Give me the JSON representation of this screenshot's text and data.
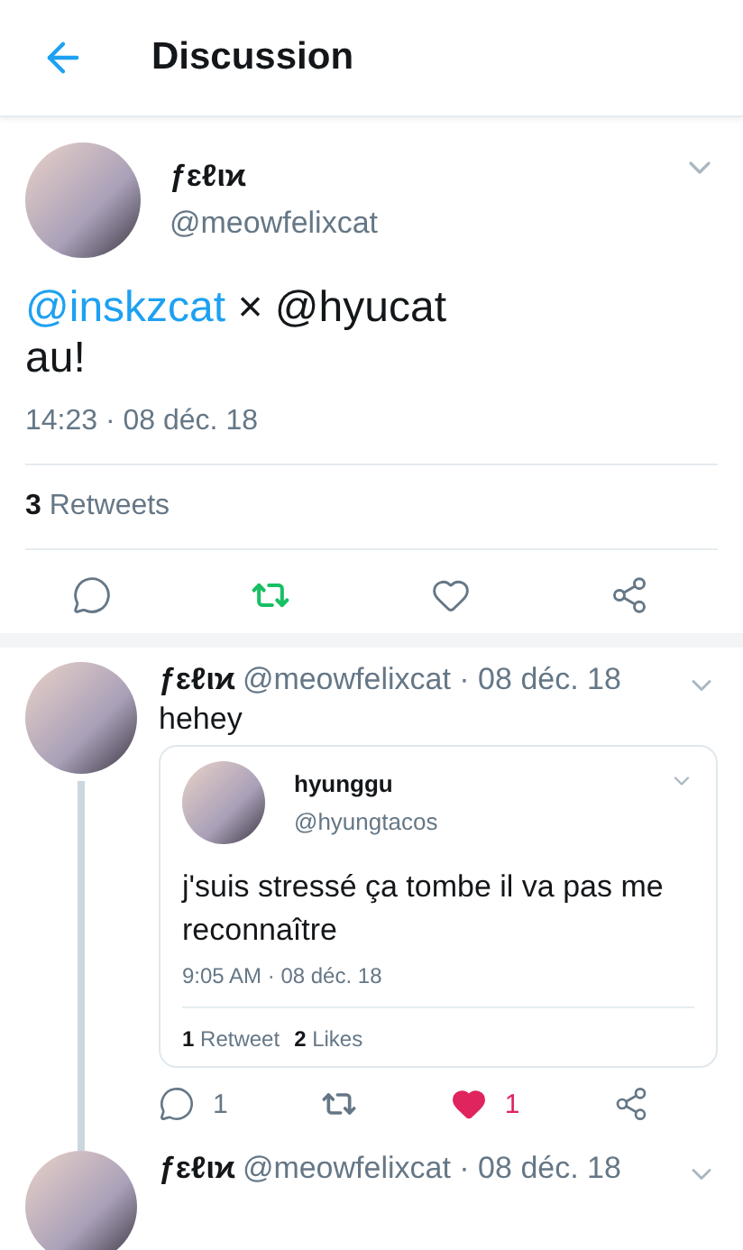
{
  "header": {
    "title": "Discussion"
  },
  "main_tweet": {
    "name": "ƒɛℓιϰ",
    "handle": "@meowfelixcat",
    "text": [
      {
        "kind": "link",
        "text": "@inskzcat"
      },
      {
        "kind": "text",
        "text": " × @hyucat"
      }
    ],
    "text_line_2": "au!",
    "time": "14:23 · 08 déc. 18",
    "retweet_count": "3",
    "retweet_label": "Retweets",
    "actions": [
      {
        "kind": "reply",
        "active": false
      },
      {
        "kind": "retweet",
        "active": true
      },
      {
        "kind": "like",
        "active": false
      },
      {
        "kind": "share",
        "active": false
      }
    ]
  },
  "replies": [
    {
      "name": "ƒɛℓιϰ",
      "handle": "@meowfelixcat · 08 déc. 18",
      "text": "hehey",
      "thread_line": true,
      "quote": {
        "name": "hyunggu",
        "handle": "@hyungtacos",
        "text": "j'suis stressé ça tombe il va pas me reconnaître",
        "time": "9:05 AM · 08 déc. 18",
        "retweets": "1",
        "retweets_label": "Retweet",
        "likes": "2",
        "likes_label": "Likes"
      },
      "actions": [
        {
          "kind": "reply",
          "active": false,
          "count": "1"
        },
        {
          "kind": "retweet",
          "active": false
        },
        {
          "kind": "like",
          "active": true,
          "count": "1"
        },
        {
          "kind": "share",
          "active": false
        }
      ]
    },
    {
      "name": "ƒɛℓιϰ",
      "handle": "@meowfelixcat · 08 déc. 18"
    }
  ]
}
